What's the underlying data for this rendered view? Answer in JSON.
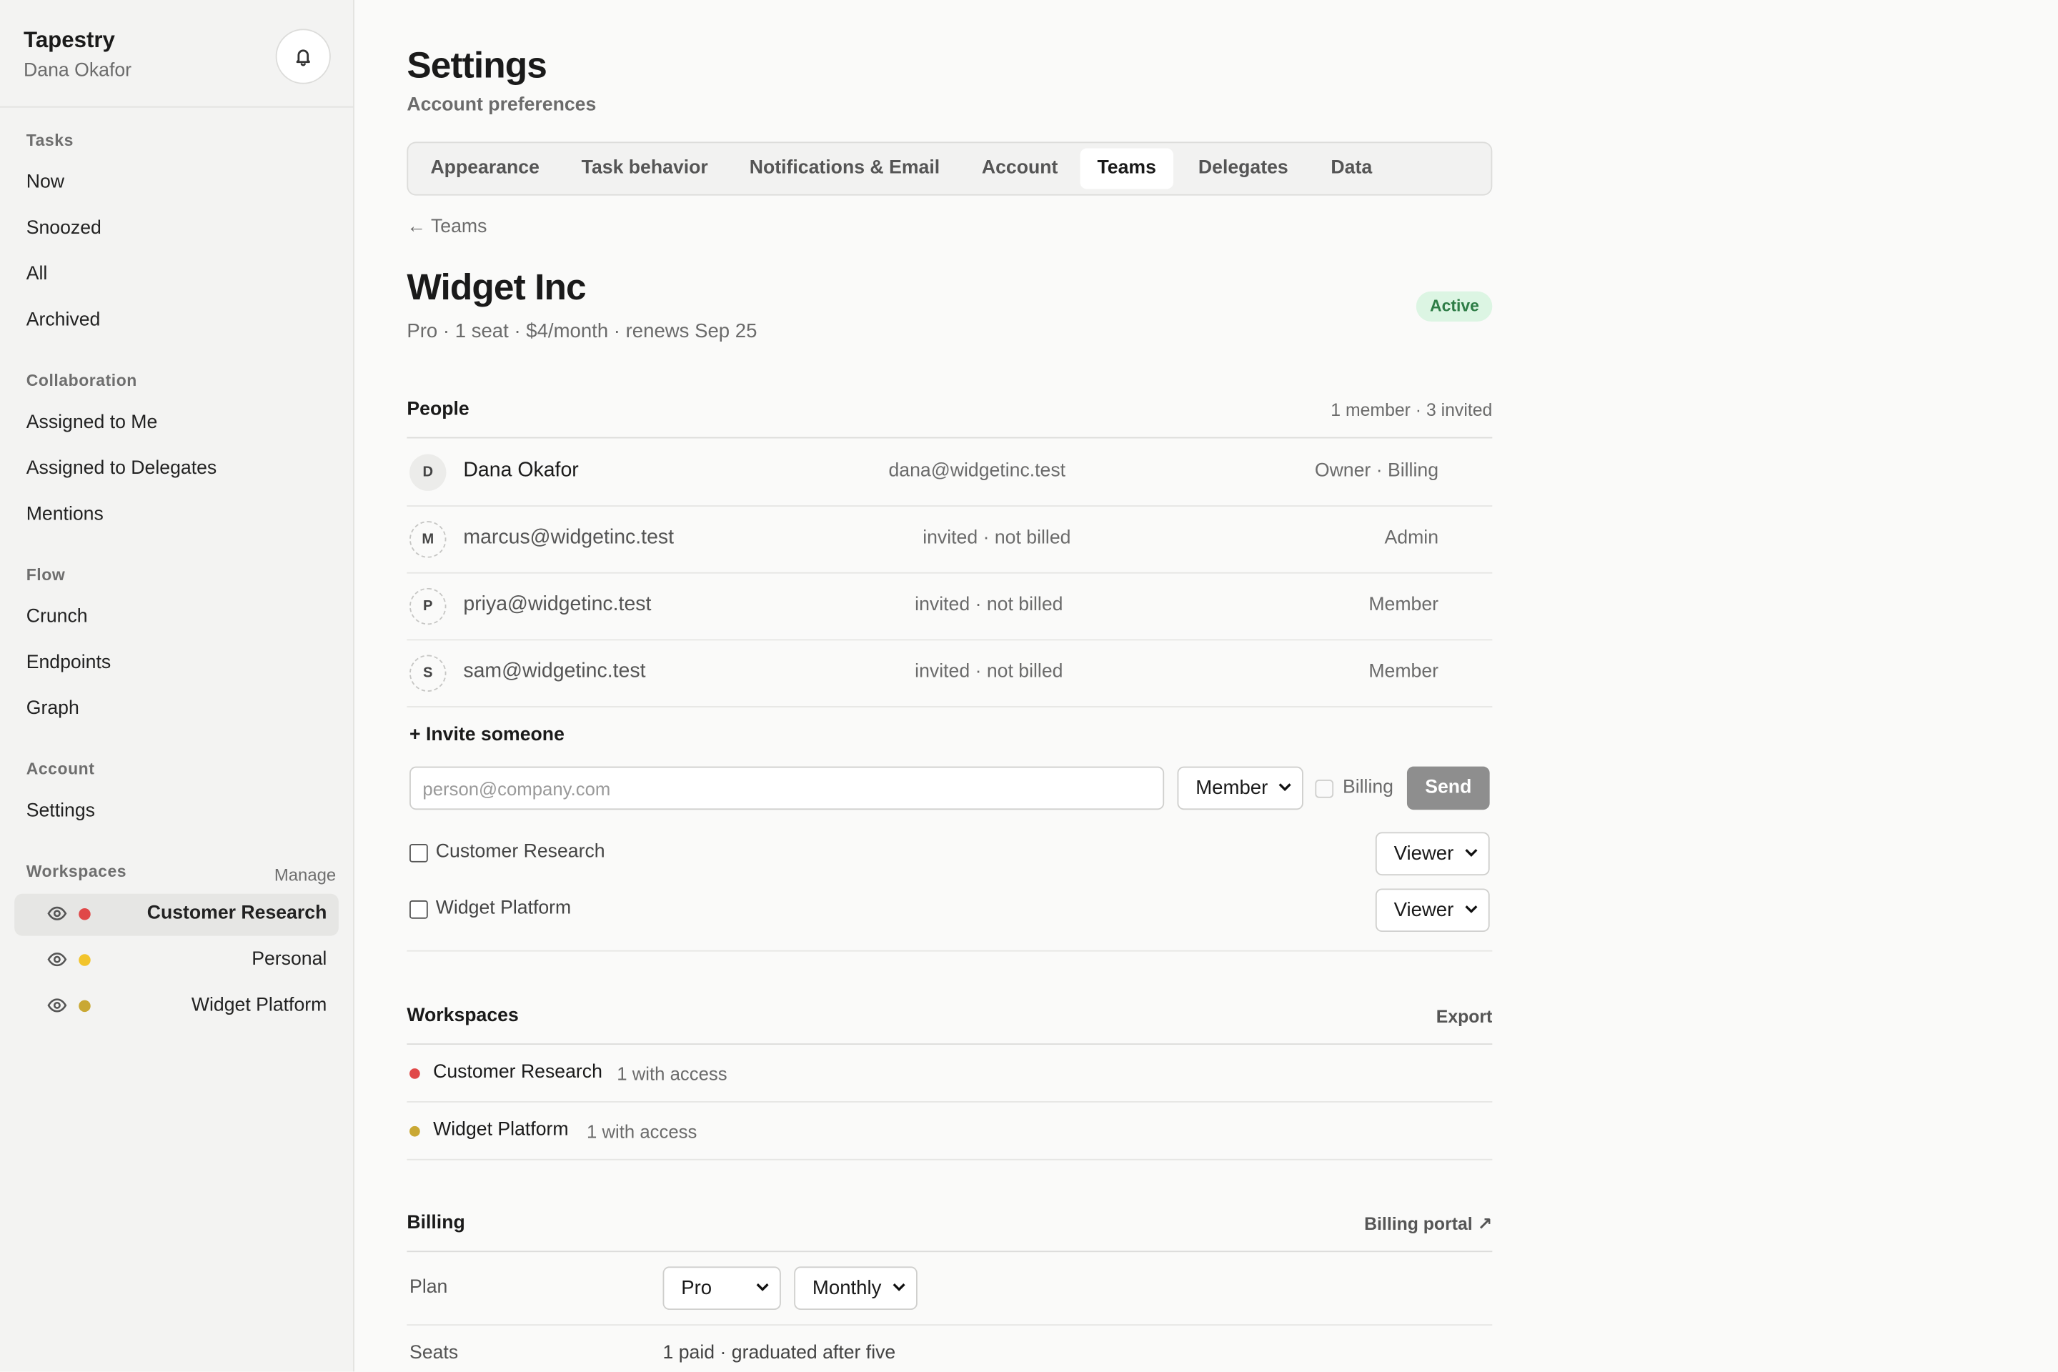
{
  "app": {
    "name": "Tapestry",
    "user": "Dana Okafor"
  },
  "sidebar": {
    "sections": [
      {
        "title": "Tasks",
        "items": [
          "Now",
          "Snoozed",
          "All",
          "Archived"
        ]
      },
      {
        "title": "Collaboration",
        "items": [
          "Assigned to Me",
          "Assigned to Delegates",
          "Mentions"
        ]
      },
      {
        "title": "Flow",
        "items": [
          "Crunch",
          "Endpoints",
          "Graph"
        ]
      },
      {
        "title": "Account",
        "items": [
          "Settings"
        ]
      }
    ],
    "workspaces_title": "Workspaces",
    "manage_label": "Manage",
    "workspaces": [
      {
        "label": "Customer Research",
        "color": "#e04848",
        "active": true
      },
      {
        "label": "Personal",
        "color": "#f2c42c",
        "active": false
      },
      {
        "label": "Widget Platform",
        "color": "#c9a834",
        "active": false
      }
    ]
  },
  "page": {
    "title": "Settings",
    "subtitle": "Account preferences"
  },
  "tabs": [
    "Appearance",
    "Task behavior",
    "Notifications & Email",
    "Account",
    "Teams",
    "Delegates",
    "Data"
  ],
  "active_tab": "Teams",
  "team": {
    "back_label": "Teams",
    "name": "Widget Inc",
    "meta": "Pro · 1 seat · $4/month · renews Sep 25",
    "status": "Active"
  },
  "people": {
    "title": "People",
    "summary": "1 member · 3 invited",
    "rows": [
      {
        "initial": "D",
        "name": "Dana Okafor",
        "status": "dana@widgetinc.test",
        "role": "Owner · Billing"
      },
      {
        "initial": "M",
        "name": "marcus@widgetinc.test",
        "status": "invited · not billed",
        "role": "Admin"
      },
      {
        "initial": "P",
        "name": "priya@widgetinc.test",
        "status": "invited · not billed",
        "role": "Member"
      },
      {
        "initial": "S",
        "name": "sam@widgetinc.test",
        "status": "invited · not billed",
        "role": "Member"
      }
    ]
  },
  "invite": {
    "heading": "+ Invite someone",
    "placeholder": "person@company.com",
    "role_selected": "Member",
    "billing_label": "Billing",
    "send_label": "Send",
    "workspaces": [
      {
        "label": "Customer Research",
        "role": "Viewer"
      },
      {
        "label": "Widget Platform",
        "role": "Viewer"
      }
    ]
  },
  "workspaces_section": {
    "title": "Workspaces",
    "action": "Export",
    "rows": [
      {
        "name": "Customer Research",
        "access": "1 with access",
        "color": "#e04848"
      },
      {
        "name": "Widget Platform",
        "access": "1 with access",
        "color": "#c9a834"
      }
    ]
  },
  "billing": {
    "title": "Billing",
    "action": "Billing portal ↗",
    "plan_label": "Plan",
    "plan_value": "Pro",
    "cycle_value": "Monthly",
    "seats_label": "Seats",
    "seats_value": "1 paid · graduated after five"
  }
}
